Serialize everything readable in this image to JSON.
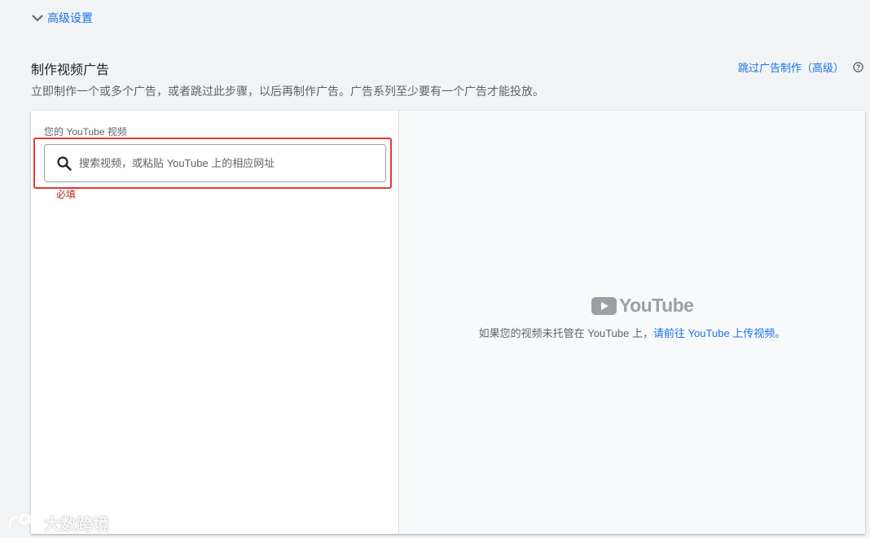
{
  "advanced": {
    "label": "高级设置"
  },
  "section": {
    "title": "制作视频广告",
    "subtitle": "立即制作一个或多个广告，或者跳过此步骤，以后再制作广告。广告系列至少要有一个广告才能投放。",
    "skip_link": "跳过广告制作（高级）"
  },
  "left_panel": {
    "field_label": "您的 YouTube 视频",
    "search_placeholder": "搜索视频，或粘贴 YouTube 上的相应网址",
    "search_value": "",
    "error_text": "必填"
  },
  "right_panel": {
    "logo_text": "YouTube",
    "note_prefix": "如果您的视频未托管在 YouTube 上，",
    "note_link": "请前往 YouTube 上传视频",
    "note_suffix": "。"
  },
  "watermark": {
    "text": "大数跨境"
  },
  "colors": {
    "accent": "#1a73e8",
    "error": "#c5221f",
    "highlight": "#e53935",
    "background": "#f1f3f4"
  }
}
